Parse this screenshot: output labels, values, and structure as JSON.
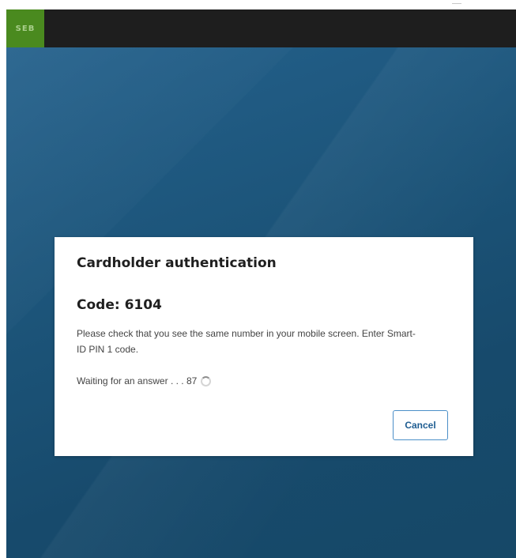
{
  "header": {
    "logo_text": "SEB"
  },
  "dialog": {
    "title": "Cardholder authentication",
    "code_label": "Code: 6104",
    "message": "Please check that you see the same number in your mobile screen. Enter Smart-ID PIN 1 code.",
    "waiting_text": "Waiting for an answer . . . 87",
    "cancel_label": "Cancel"
  },
  "colors": {
    "brand_green": "#4a8a1f",
    "topbar": "#1e1e1e",
    "background_blue": "#1c5479",
    "button_border": "#4b8fc8",
    "button_text": "#1f5d91"
  },
  "icons": {
    "spinner": "loading-spinner-icon"
  }
}
